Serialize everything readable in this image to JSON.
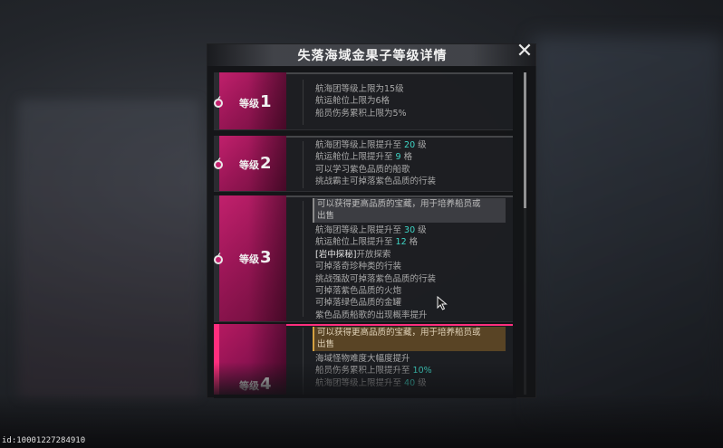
{
  "dialog": {
    "title": "失落海域金果子等级详情",
    "close_label": "✕"
  },
  "levels": [
    {
      "label": "等级",
      "num": "1",
      "lines": [
        {
          "text": "航海团等级上限为15级"
        },
        {
          "text": "航运舱位上限为6格"
        },
        {
          "text": "船员伤务累积上限为5%"
        }
      ]
    },
    {
      "label": "等级",
      "num": "2",
      "lines": [
        {
          "pre": "航海团等级上限提升至 ",
          "hl": "20",
          "post": " 级"
        },
        {
          "pre": "航运舱位上限提升至 ",
          "hl": "9",
          "post": " 格"
        },
        {
          "text": "可以学习紫色品质的船歌"
        },
        {
          "text": "挑战霸主可掉落紫色品质的行装"
        }
      ]
    },
    {
      "label": "等级",
      "num": "3",
      "hint": [
        "可以获得更高品质的宝藏，用于培养船员或",
        "出售"
      ],
      "lines": [
        {
          "pre": "航海团等级上限提升至 ",
          "hl": "30",
          "post": " 级"
        },
        {
          "pre": "航运舱位上限提升至 ",
          "hl": "12",
          "post": " 格"
        },
        {
          "tag": "[岩中探秘]",
          "post": "开放探索"
        },
        {
          "text": "可掉落奇珍种类的行装"
        },
        {
          "text": "挑战强敌可掉落紫色品质的行装"
        },
        {
          "text": "可掉落紫色品质的火炮"
        },
        {
          "text": "可掉落绿色品质的金罐"
        },
        {
          "text": "紫色品质船歌的出现概率提升"
        }
      ]
    },
    {
      "label": "等级",
      "num": "4",
      "hint": [
        "可以获得更高品质的宝藏，用于培养船员或",
        "出售"
      ],
      "lines": [
        {
          "text": "海域怪物难度大幅度提升"
        },
        {
          "pre": "船员伤务累积上限提升至 ",
          "hl": "10%",
          "post": ""
        },
        {
          "pre": "航海团等级上限提升至 ",
          "hl": "40",
          "post": " 级"
        }
      ]
    }
  ],
  "footer": {
    "uid": "id:10001227284910"
  },
  "colors": {
    "accent": "#c4216e",
    "highlight": "#3fd6c6",
    "hint_gold": "#d4a040"
  }
}
